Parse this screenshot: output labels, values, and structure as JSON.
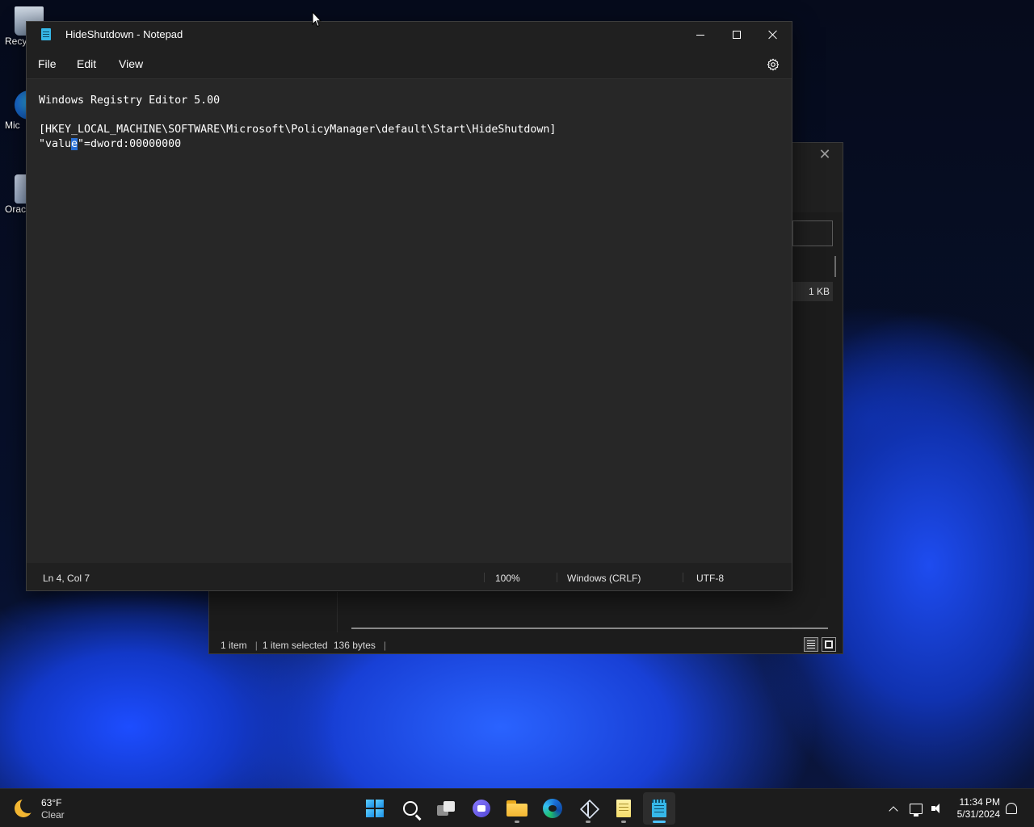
{
  "desktop": {
    "icons": [
      {
        "label": "Recy"
      },
      {
        "label": "Mic"
      },
      {
        "label": "Orac"
      }
    ]
  },
  "explorer": {
    "size_cell": "1 KB",
    "status": {
      "count": "1 item",
      "selected": "1 item selected",
      "size": "136 bytes"
    }
  },
  "notepad": {
    "title": "HideShutdown - Notepad",
    "menu": {
      "file": "File",
      "edit": "Edit",
      "view": "View"
    },
    "lines": [
      "Windows Registry Editor 5.00",
      "",
      "[HKEY_LOCAL_MACHINE\\SOFTWARE\\Microsoft\\PolicyManager\\default\\Start\\HideShutdown]"
    ],
    "line4": {
      "before": "\"valu",
      "selected": "e",
      "after": "\"=dword:00000000"
    },
    "statusbar": {
      "position": "Ln 4, Col 7",
      "zoom": "100%",
      "line_ending": "Windows (CRLF)",
      "encoding": "UTF-8"
    }
  },
  "taskbar": {
    "weather": {
      "temperature": "63°F",
      "condition": "Clear"
    },
    "apps": [
      {
        "name": "start",
        "icon": "windows-logo-icon"
      },
      {
        "name": "search",
        "icon": "search-icon"
      },
      {
        "name": "task-view",
        "icon": "task-view-icon"
      },
      {
        "name": "chat",
        "icon": "chat-icon"
      },
      {
        "name": "file-explorer",
        "icon": "folder-icon"
      },
      {
        "name": "edge",
        "icon": "edge-icon"
      },
      {
        "name": "virtualbox",
        "icon": "cube-icon"
      },
      {
        "name": "notes",
        "icon": "notes-icon"
      },
      {
        "name": "notepad",
        "icon": "notepad-icon",
        "active": true
      }
    ],
    "clock": {
      "time": "11:34 PM",
      "date": "5/31/2024"
    }
  },
  "colors": {
    "accent": "#4cc2ff",
    "selection": "#2a70d6",
    "window_bg": "#272727",
    "chrome_bg": "#202020"
  }
}
